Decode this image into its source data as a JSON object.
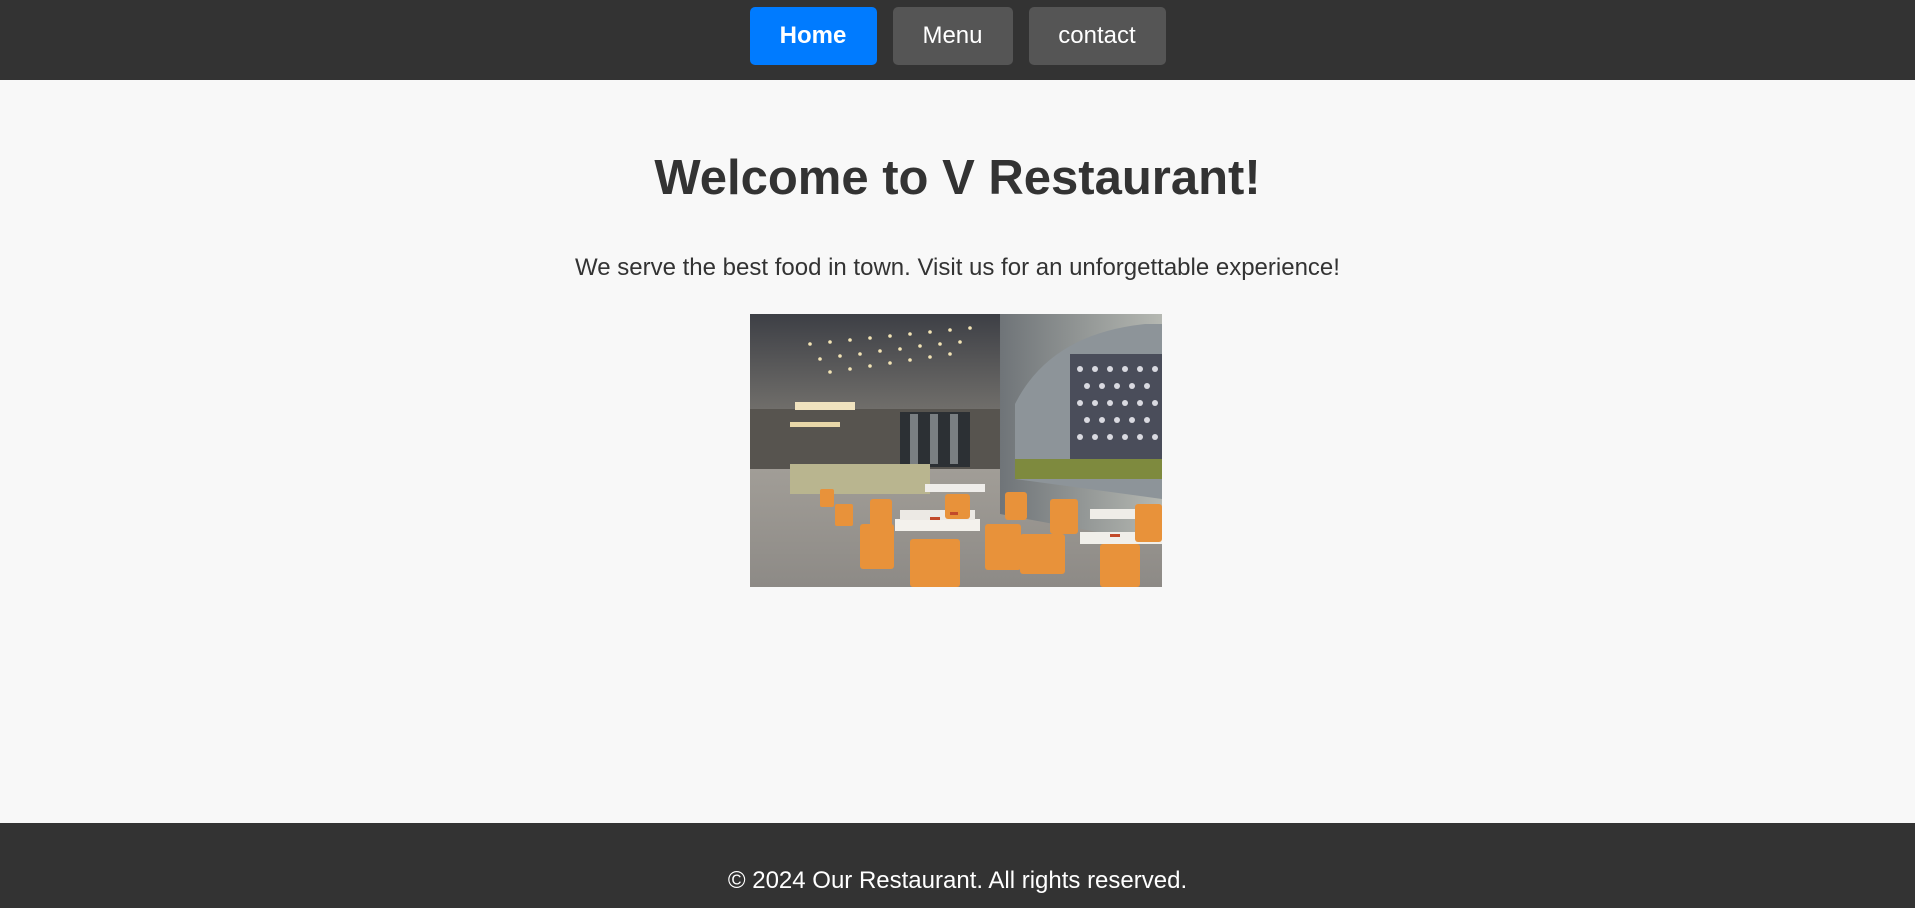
{
  "nav": {
    "items": [
      {
        "label": "Home",
        "active": true
      },
      {
        "label": "Menu",
        "active": false
      },
      {
        "label": "contact",
        "active": false
      }
    ]
  },
  "main": {
    "title": "Welcome to V Restaurant!",
    "tagline": "We serve the best food in town. Visit us for an unforgettable experience!"
  },
  "footer": {
    "text": "© 2024 Our Restaurant. All rights reserved."
  },
  "colors": {
    "nav_bg": "#333333",
    "active_button": "#007bff",
    "inactive_button": "#555555",
    "page_bg": "#f8f8f8"
  }
}
